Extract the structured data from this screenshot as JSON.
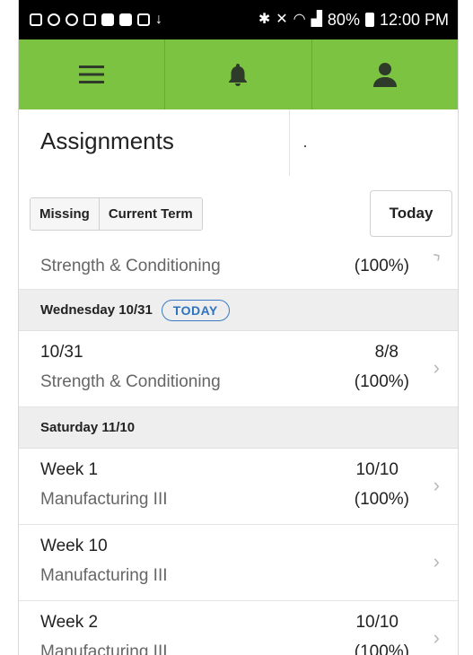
{
  "status_bar": {
    "battery": "80%",
    "time": "12:00 PM"
  },
  "top_nav": {
    "items": [
      {
        "icon": "hamburger-menu-icon"
      },
      {
        "icon": "bell-icon"
      },
      {
        "icon": "user-icon"
      }
    ],
    "color": "#7dc342"
  },
  "page": {
    "title": "Assignments"
  },
  "filters": {
    "missing_label": "Missing",
    "current_term_label": "Current Term",
    "today_label": "Today"
  },
  "list": {
    "partial_row": {
      "course": "Strength & Conditioning",
      "percent": "(100%)"
    },
    "day1": {
      "label": "Wednesday 10/31",
      "badge": "TODAY"
    },
    "row1": {
      "name": "10/31",
      "course": "Strength & Conditioning",
      "score": "8/8",
      "percent": "(100%)"
    },
    "day2": {
      "label": "Saturday 11/10"
    },
    "row2": {
      "name": "Week 1",
      "course": "Manufacturing III",
      "score": "10/10",
      "percent": "(100%)"
    },
    "row3": {
      "name": "Week 10",
      "course": "Manufacturing III",
      "score": "",
      "percent": ""
    },
    "row4": {
      "name": "Week 2",
      "course": "Manufacturing III",
      "score": "10/10",
      "percent": "(100%)"
    }
  },
  "colors": {
    "accent_green": "#7dc342",
    "badge_blue": "#2d73bf"
  }
}
